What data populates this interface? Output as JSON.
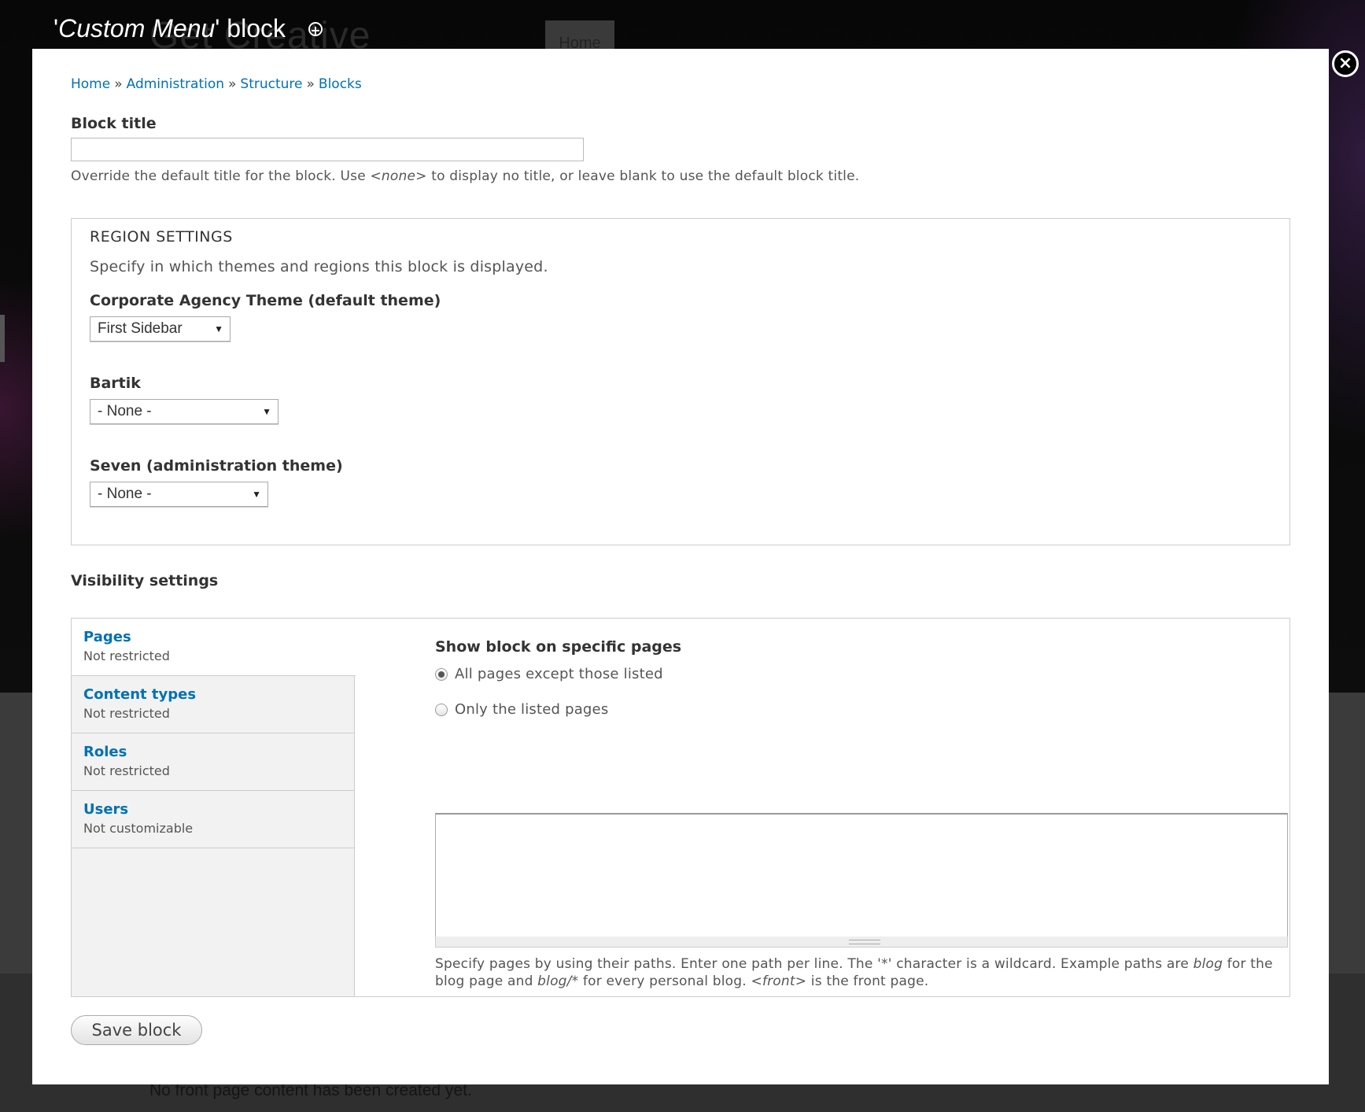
{
  "background": {
    "site_title": "Get Creative",
    "nav_home": "Home",
    "footer_text": "No front page content has been created yet."
  },
  "overlay": {
    "title_quote_open": "'",
    "title_italic": "Custom Menu",
    "title_rest": "' block",
    "plus_icon": "+",
    "close_icon": "×"
  },
  "breadcrumb": {
    "items": [
      "Home",
      "Administration",
      "Structure",
      "Blocks"
    ],
    "separator": "»"
  },
  "block_title": {
    "label": "Block title",
    "value": "",
    "description_pre": "Override the default title for the block. Use ",
    "description_em": "<none>",
    "description_post": " to display no title, or leave blank to use the default block title."
  },
  "region_settings": {
    "legend": "REGION SETTINGS",
    "description": "Specify in which themes and regions this block is displayed.",
    "themes": [
      {
        "label": "Corporate Agency Theme (default theme)",
        "selected": "First Sidebar"
      },
      {
        "label": "Bartik",
        "selected": "- None -"
      },
      {
        "label": "Seven (administration theme)",
        "selected": "- None -"
      }
    ]
  },
  "visibility": {
    "heading": "Visibility settings",
    "tabs": [
      {
        "title": "Pages",
        "summary": "Not restricted"
      },
      {
        "title": "Content types",
        "summary": "Not restricted"
      },
      {
        "title": "Roles",
        "summary": "Not restricted"
      },
      {
        "title": "Users",
        "summary": "Not customizable"
      }
    ],
    "pages_pane": {
      "heading": "Show block on specific pages",
      "options": [
        {
          "label": "All pages except those listed",
          "checked": true
        },
        {
          "label": "Only the listed pages",
          "checked": false
        }
      ],
      "textarea_value": "",
      "help_line1_pre": "Specify pages by using their paths. Enter one path per line. The '*' character is a wildcard. Example paths are ",
      "help_line1_em": "blog",
      "help_line1_post": " for the",
      "help_line2_pre": "blog page and ",
      "help_line2_em": "blog/*",
      "help_line2_mid": " for every personal blog. ",
      "help_line2_em2": "<front>",
      "help_line2_post": " is the front page."
    }
  },
  "save_button": "Save block"
}
